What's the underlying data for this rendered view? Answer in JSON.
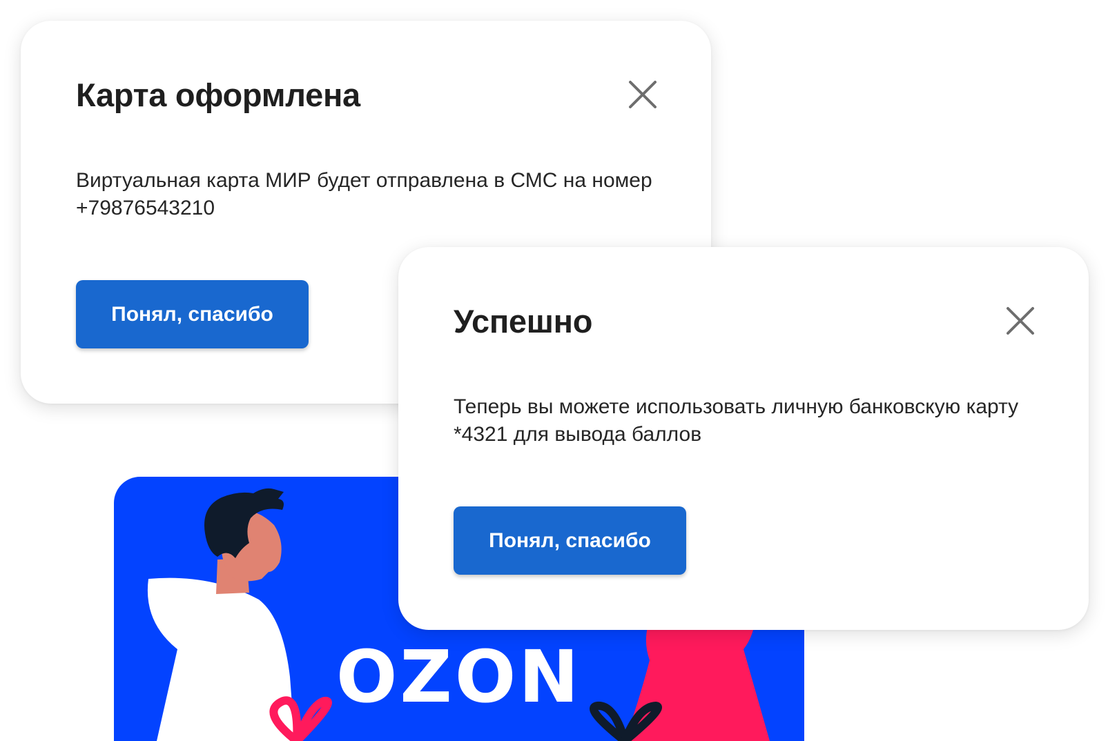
{
  "dialogs": [
    {
      "title": "Карта оформлена",
      "text": "Виртуальная карта МИР будет отправлена в СМС на номер +79876543210",
      "button": "Понял, спасибо",
      "close_icon": "close-icon"
    },
    {
      "title": "Успешно",
      "text": "Теперь вы можете использовать личную банковскую карту *4321 для вывода баллов",
      "button": "Понял, спасибо",
      "close_icon": "close-icon"
    }
  ],
  "promo": {
    "logo_text": "OZON",
    "colors": {
      "background": "#0343ff",
      "accent_pink": "#ff1a5c",
      "button_blue": "#1968cf"
    }
  }
}
